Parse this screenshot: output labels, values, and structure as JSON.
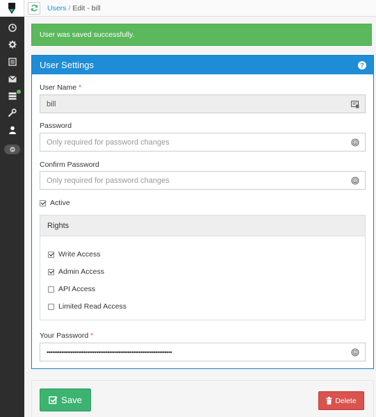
{
  "breadcrumb": {
    "users_link": "Users",
    "separator": "/",
    "current": "Edit - bill"
  },
  "alert": {
    "message": "User was saved successfully."
  },
  "panel": {
    "title": "User Settings"
  },
  "form": {
    "username": {
      "label": "User Name",
      "required_mark": "*",
      "value": "bill"
    },
    "password": {
      "label": "Password",
      "placeholder": "Only required for password changes"
    },
    "confirm_password": {
      "label": "Confirm Password",
      "placeholder": "Only required for password changes"
    },
    "active": {
      "label": "Active",
      "checked": true
    },
    "rights": {
      "title": "Rights",
      "items": [
        {
          "label": "Write Access",
          "checked": true
        },
        {
          "label": "Admin Access",
          "checked": true
        },
        {
          "label": "API Access",
          "checked": false
        },
        {
          "label": "Limited Read Access",
          "checked": false
        }
      ]
    },
    "your_password": {
      "label": "Your Password",
      "required_mark": "*",
      "value": "••••••••••••••••••••••••••••••••••••••••••••••••••••••••••••••••••••"
    }
  },
  "buttons": {
    "save": "Save",
    "delete": "Delete"
  },
  "sidebar": {
    "icons": [
      "clock-icon",
      "gear-icon",
      "list-icon",
      "envelope-icon",
      "server-icon",
      "wrench-icon",
      "user-icon"
    ]
  },
  "colors": {
    "primary": "#1f8dd6",
    "success": "#5cb85c",
    "save": "#3cb371",
    "danger": "#d9534f",
    "sidebar": "#2d2d2d"
  }
}
